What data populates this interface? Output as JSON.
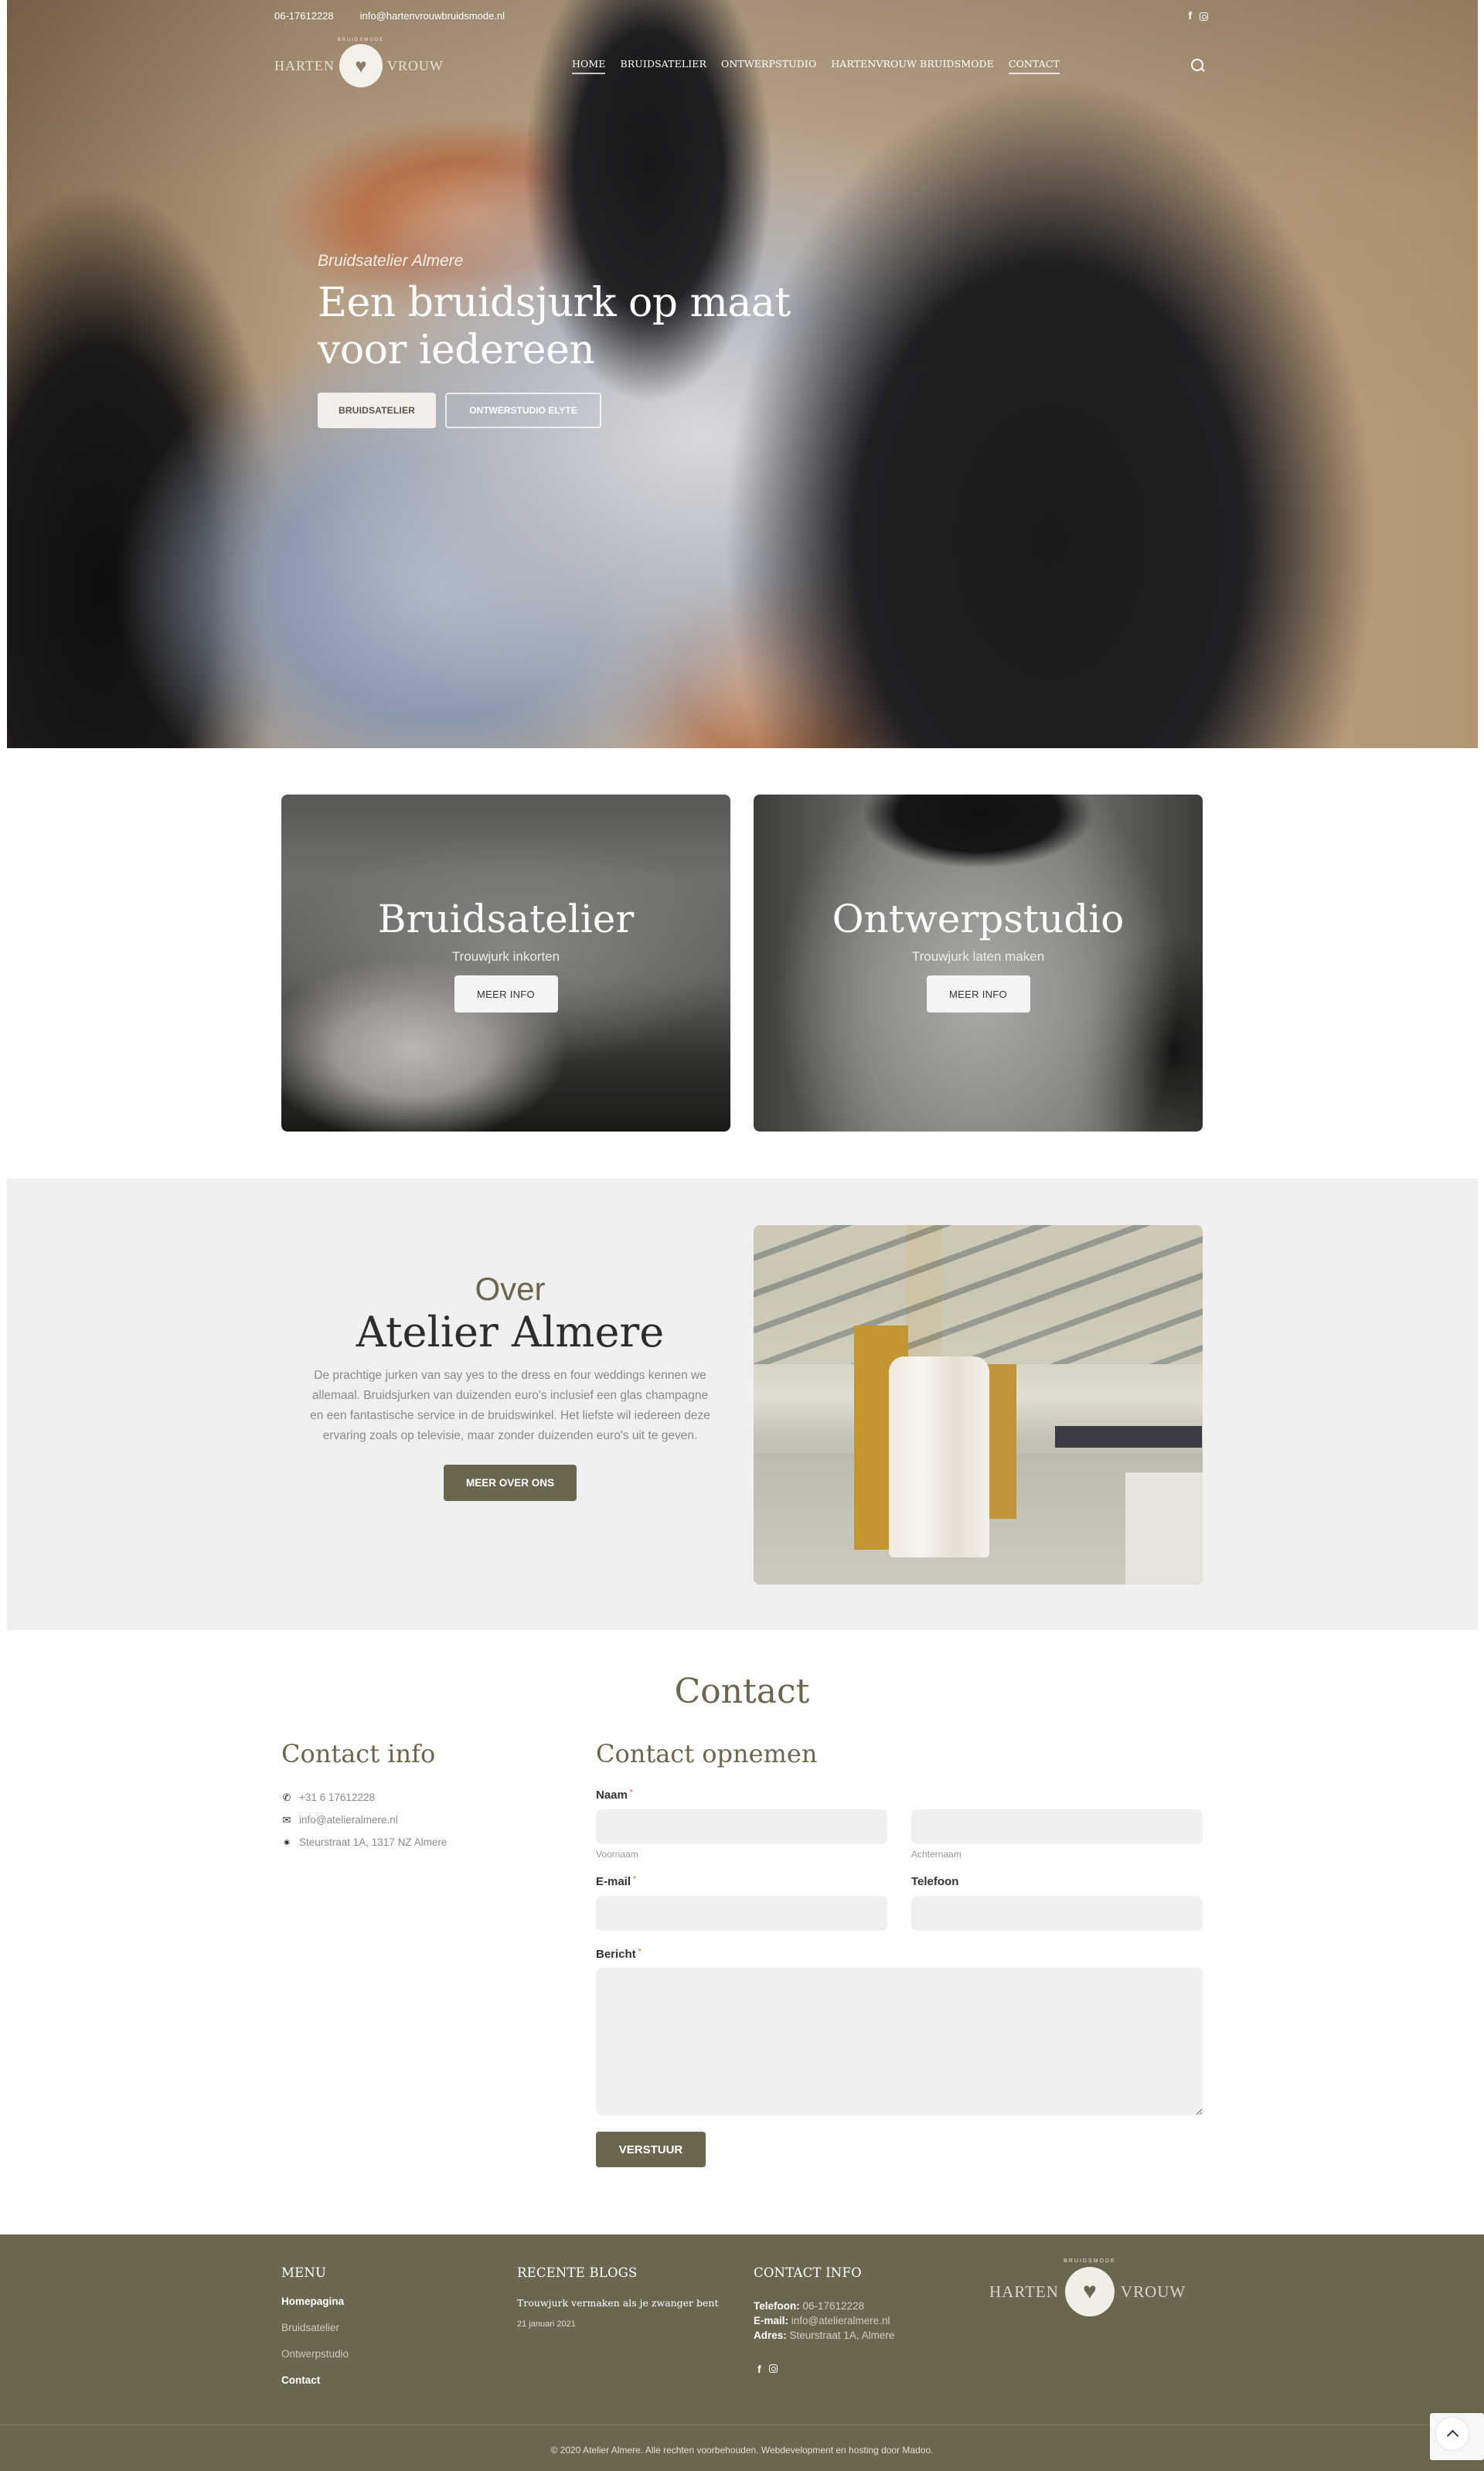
{
  "topbar": {
    "phone": "06-17612228",
    "email": "info@hartenvrouwbruidsmode.nl",
    "social": [
      {
        "icon": "facebook-icon",
        "glyph": "f"
      },
      {
        "icon": "instagram-icon",
        "glyph": ""
      }
    ]
  },
  "brand": {
    "left_word": "HARTEN",
    "right_word": "VROUW",
    "arc_text": "BRUIDSMODE",
    "emblem_icon": "heart-dress-icon",
    "emblem_glyph": "♥"
  },
  "nav": {
    "items": [
      {
        "label": "HOME",
        "active": true
      },
      {
        "label": "BRUIDSATELIER",
        "active": false
      },
      {
        "label": "ONTWERPSTUDIO",
        "active": false
      },
      {
        "label": "HARTENVROUW BRUIDSMODE",
        "active": false
      },
      {
        "label": "CONTACT",
        "active": true
      }
    ],
    "search_icon": "search-icon"
  },
  "hero": {
    "kicker": "Bruidsatelier Almere",
    "title_line1": "Een bruidsjurk op maat",
    "title_line2": "voor iedereen",
    "btn_primary": "BRUIDSATELIER",
    "btn_secondary": "ONTWERSTUDIO ELYTE"
  },
  "cards": [
    {
      "title": "Bruidsatelier",
      "subtitle": "Trouwjurk inkorten",
      "button": "MEER INFO"
    },
    {
      "title": "Ontwerpstudio",
      "subtitle": "Trouwjurk laten maken",
      "button": "MEER INFO"
    }
  ],
  "about": {
    "kicker": "Over",
    "title": "Atelier Almere",
    "body": "De prachtige jurken van say yes to the dress en four weddings kennen we allemaal. Bruidsjurken van duizenden euro's inclusief een glas champagne en een fantastische service in de bruidswinkel. Het liefste wil iedereen deze ervaring zoals op televisie, maar zonder duizenden euro's uit te geven.",
    "button": "MEER OVER ONS"
  },
  "contact": {
    "title": "Contact",
    "info": {
      "heading": "Contact info",
      "items": [
        {
          "icon": "phone-icon",
          "glyph": "✆",
          "text": "+31 6 17612228"
        },
        {
          "icon": "envelope-icon",
          "glyph": "✉",
          "text": "info@atelieralmere.nl"
        },
        {
          "icon": "map-pin-icon",
          "glyph": "⬤",
          "text": "Steurstraat 1A, 1317 NZ Almere"
        }
      ]
    },
    "form": {
      "heading": "Contact opnemen",
      "required_mark": "*",
      "name_label": "Naam",
      "first_name_help": "Voornaam",
      "last_name_help": "Achternaam",
      "first_name_value": "",
      "last_name_value": "",
      "email_label": "E-mail",
      "email_value": "",
      "phone_label": "Telefoon",
      "phone_value": "",
      "message_label": "Bericht",
      "message_value": "",
      "submit": "VERSTUUR"
    }
  },
  "footer": {
    "menu": {
      "heading": "MENU",
      "items": [
        {
          "label": "Homepagina",
          "highlight": true
        },
        {
          "label": "Bruidsatelier",
          "highlight": false
        },
        {
          "label": "Ontwerpstudio",
          "highlight": false
        },
        {
          "label": "Contact",
          "highlight": true
        }
      ]
    },
    "blogs": {
      "heading": "RECENTE BLOGS",
      "post_title": "Trouwjurk vermaken als je zwanger bent",
      "post_date": "21 januari 2021"
    },
    "contact": {
      "heading": "CONTACT INFO",
      "phone_label": "Telefoon:",
      "phone": "06-17612228",
      "email_label": "E-mail:",
      "email": "info@atelieralmere.nl",
      "address_label": "Adres:",
      "address": "Steurstraat 1A, Almere"
    },
    "copyright": "© 2020 Atelier Almere. Alle rechten voorbehouden. Webdevelopment en hosting door Madoo.",
    "back_to_top_icon": "chevron-up-icon"
  },
  "colors": {
    "brand_olive": "#6b6650",
    "input_bg": "#f0f0f0",
    "about_bg": "#f0f0f0"
  }
}
